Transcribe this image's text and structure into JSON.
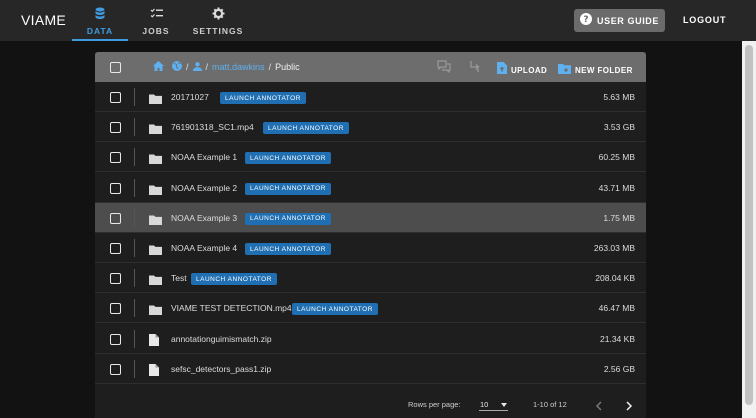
{
  "app": {
    "title": "VIAME",
    "nav": [
      {
        "label": "DATA",
        "icon": "database-icon"
      },
      {
        "label": "JOBS",
        "icon": "jobs-list-icon"
      },
      {
        "label": "SETTINGS",
        "icon": "gear-icon"
      }
    ],
    "user_guide_label": "USER GUIDE",
    "logout_label": "LOGOUT"
  },
  "colors": {
    "accent": "#3f9bdf",
    "launch_button": "#1f6fb2",
    "toolbar": "#6d6d6d"
  },
  "breadcrumb": {
    "separator": "/",
    "user": "matt.dawkins",
    "current": "Public"
  },
  "toolbar": {
    "upload_label": "UPLOAD",
    "new_folder_label": "NEW FOLDER"
  },
  "launch_label": "LAUNCH ANNOTATOR",
  "rows": [
    {
      "name": "20171027",
      "type": "folder",
      "launch": true,
      "size": "5.63 MB"
    },
    {
      "name": "761901318_SC1.mp4",
      "type": "folder",
      "launch": true,
      "size": "3.53 GB"
    },
    {
      "name": "NOAA Example 1",
      "type": "folder",
      "launch": true,
      "size": "60.25 MB"
    },
    {
      "name": "NOAA Example 2",
      "type": "folder",
      "launch": true,
      "size": "43.71 MB"
    },
    {
      "name": "NOAA Example 3",
      "type": "folder",
      "launch": true,
      "size": "1.75 MB",
      "selected": true
    },
    {
      "name": "NOAA Example 4",
      "type": "folder",
      "launch": true,
      "size": "263.03 MB"
    },
    {
      "name": "Test",
      "type": "folder",
      "launch": true,
      "size": "208.04 KB"
    },
    {
      "name": "VIAME TEST DETECTION.mp4",
      "type": "folder",
      "launch": true,
      "size": "46.47 MB"
    },
    {
      "name": "annotationguimismatch.zip",
      "type": "file",
      "launch": false,
      "size": "21.34 KB"
    },
    {
      "name": "sefsc_detectors_pass1.zip",
      "type": "file",
      "launch": false,
      "size": "2.56 GB"
    }
  ],
  "pagination": {
    "rows_per_page_label": "Rows per page:",
    "rows_per_page": "10",
    "range": "1-10 of 12"
  }
}
